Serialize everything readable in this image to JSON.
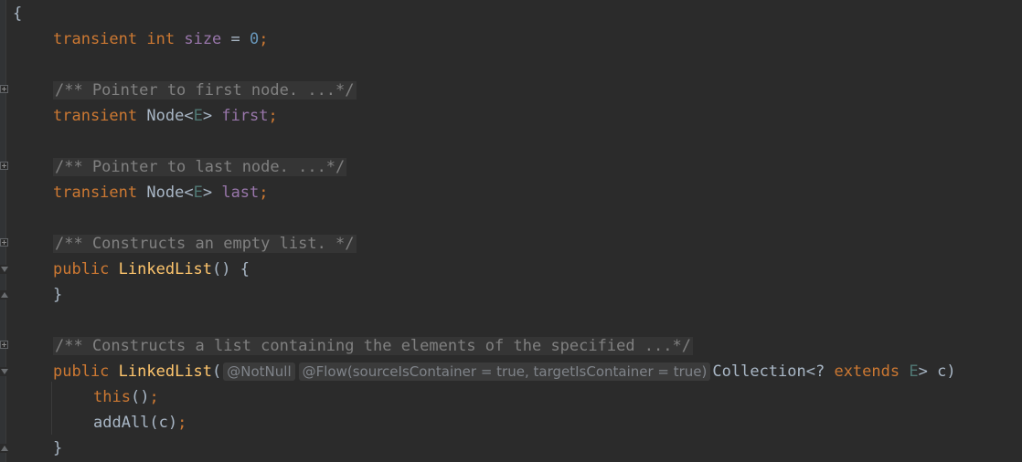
{
  "editor": {
    "lines": {
      "l0": {
        "brace": "{"
      },
      "l1": {
        "kw": "transient",
        "type": "int",
        "name": "size",
        "op": " = ",
        "num": "0",
        "semi": ";"
      },
      "l3": {
        "comment": "/** Pointer to first node. ...*/"
      },
      "l4": {
        "kw": "transient",
        "type": "Node",
        "lt": "<",
        "tp": "E",
        "gt": ">",
        "name": "first",
        "semi": ";"
      },
      "l6": {
        "comment": "/** Pointer to last node. ...*/"
      },
      "l7": {
        "kw": "transient",
        "type": "Node",
        "lt": "<",
        "tp": "E",
        "gt": ">",
        "name": "last",
        "semi": ";"
      },
      "l9": {
        "comment": "/** Constructs an empty list. */"
      },
      "l10": {
        "kw": "public",
        "fn": "LinkedList",
        "rest": "() {"
      },
      "l11": {
        "brace": "}"
      },
      "l13": {
        "comment": "/** Constructs a list containing the elements of the specified ...*/"
      },
      "l14": {
        "kw": "public",
        "fn": "LinkedList",
        "paren": "(",
        "hint1": "@NotNull",
        "hint2": "@Flow(sourceIsContainer = true, targetIsContainer = true)",
        "type": "Collection<? ",
        "ext": "extends",
        "tp": "E",
        "rest": "> c)"
      },
      "l15": {
        "kw": "this",
        "rest": "()",
        "semi": ";"
      },
      "l16": {
        "call": "addAll(c)",
        "semi": ";"
      },
      "l17": {
        "brace": "}"
      }
    }
  },
  "colors": {
    "background": "#2b2b2b",
    "keyword": "#cc7832",
    "number": "#6897bb",
    "field": "#9876aa",
    "type_param": "#507874",
    "method": "#ffc66d",
    "comment": "#808080",
    "text": "#a9b7c6"
  }
}
